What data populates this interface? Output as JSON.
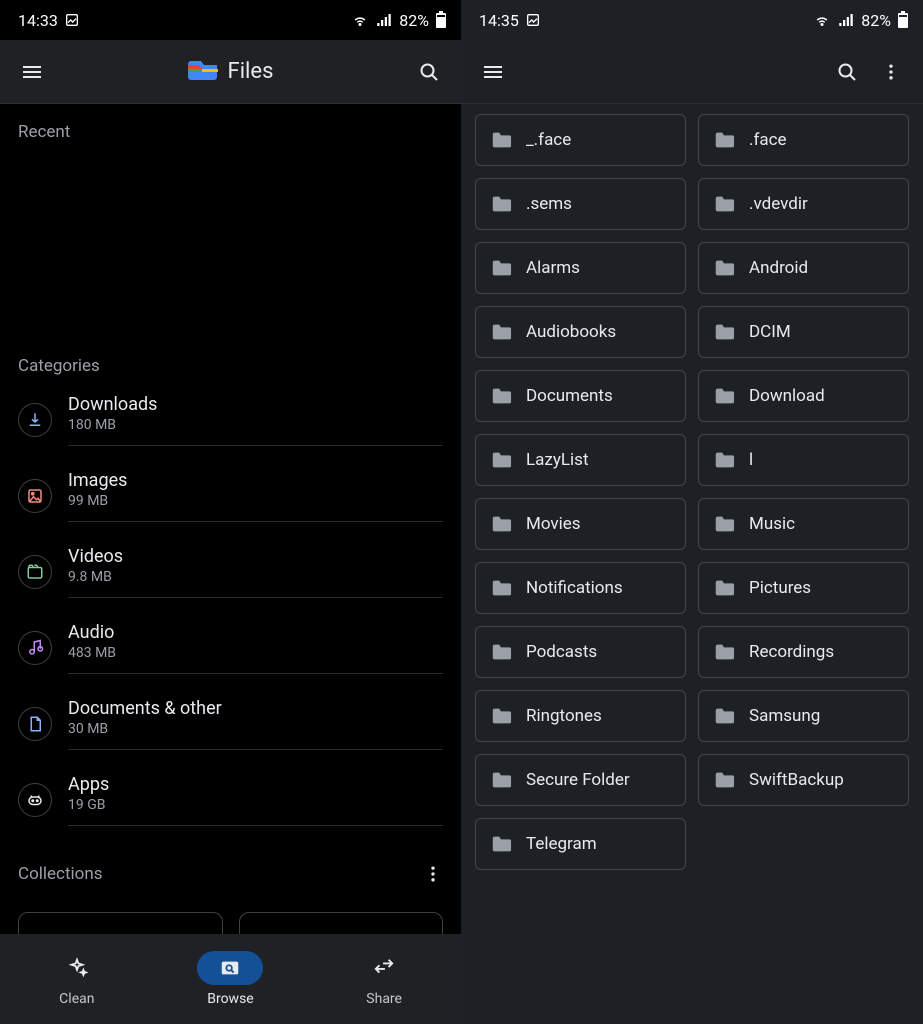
{
  "left": {
    "status": {
      "time": "14:33",
      "battery": "82%"
    },
    "appbar": {
      "title": "Files"
    },
    "recent_title": "Recent",
    "categories_title": "Categories",
    "categories": [
      {
        "name": "Downloads",
        "size": "180 MB",
        "icon": "download",
        "color": "#8ab4f8"
      },
      {
        "name": "Images",
        "size": "99 MB",
        "icon": "image",
        "color": "#f28b82"
      },
      {
        "name": "Videos",
        "size": "9.8 MB",
        "icon": "video",
        "color": "#81c995"
      },
      {
        "name": "Audio",
        "size": "483 MB",
        "icon": "audio",
        "color": "#c58af9"
      },
      {
        "name": "Documents & other",
        "size": "30 MB",
        "icon": "document",
        "color": "#8ab4f8"
      },
      {
        "name": "Apps",
        "size": "19 GB",
        "icon": "apps",
        "color": "#e8eaed"
      }
    ],
    "collections_title": "Collections",
    "nav": [
      {
        "label": "Clean",
        "icon": "sparkle",
        "active": false
      },
      {
        "label": "Browse",
        "icon": "browse",
        "active": true
      },
      {
        "label": "Share",
        "icon": "share",
        "active": false
      }
    ]
  },
  "right": {
    "status": {
      "time": "14:35",
      "battery": "82%"
    },
    "folders": [
      "_.face",
      ".face",
      ".sems",
      ".vdevdir",
      "Alarms",
      "Android",
      "Audiobooks",
      "DCIM",
      "Documents",
      "Download",
      "LazyList",
      "l",
      "Movies",
      "Music",
      "Notifications",
      "Pictures",
      "Podcasts",
      "Recordings",
      "Ringtones",
      "Samsung",
      "Secure Folder",
      "SwiftBackup",
      "Telegram"
    ]
  }
}
